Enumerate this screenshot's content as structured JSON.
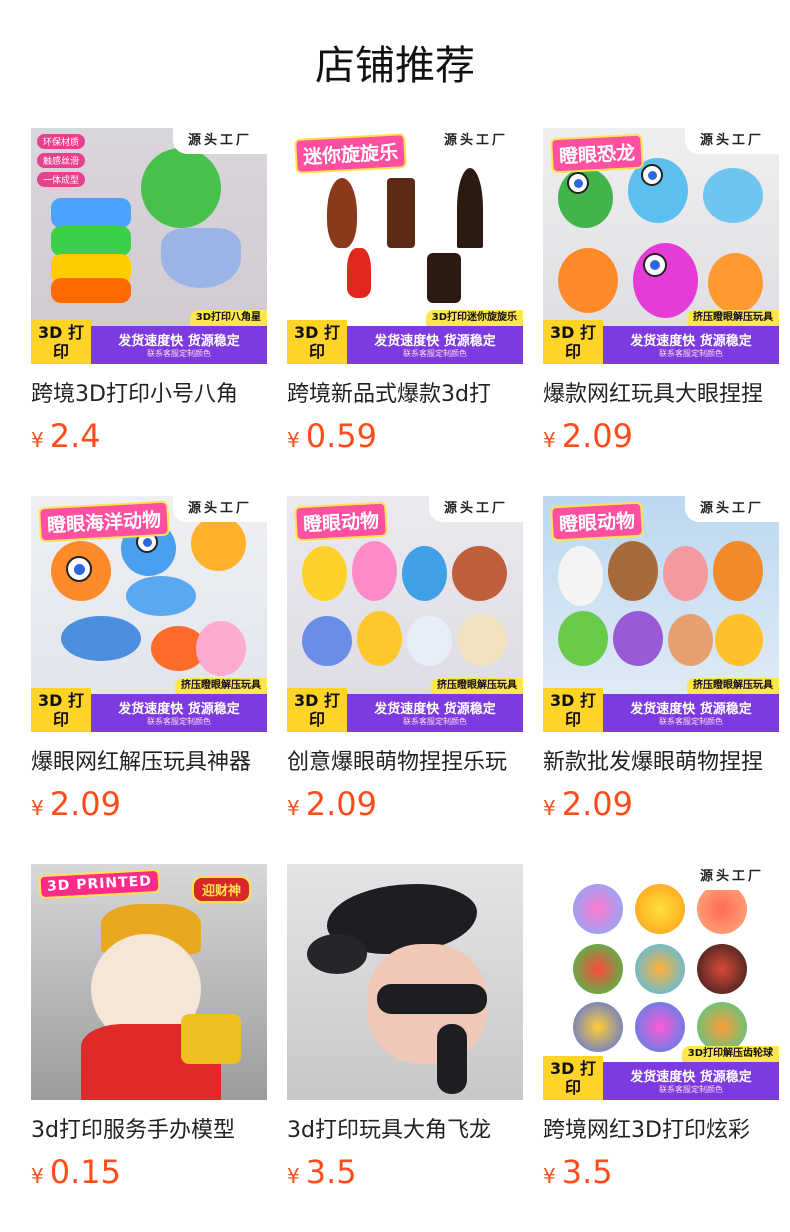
{
  "page_title": "店铺推荐",
  "products": [
    {
      "title": "跨境3D打印小号八角",
      "currency": "¥",
      "price": "2.4",
      "image": {
        "headline": "",
        "chips": [
          "环保材质",
          "触感丝滑",
          "一体成型"
        ],
        "tag": "3D打印八角星",
        "corner": "源头工厂",
        "badge_text": "3D 打印",
        "bar_main": "发货速度快 货源稳定",
        "bar_sub": "联系客服定制颜色"
      }
    },
    {
      "title": "跨境新品式爆款3d打",
      "currency": "¥",
      "price": "0.59",
      "image": {
        "headline": "迷你旋旋乐",
        "chips": [],
        "tag": "3D打印迷你旋旋乐",
        "corner": "源头工厂",
        "badge_text": "3D 打印",
        "bar_main": "发货速度快 货源稳定",
        "bar_sub": "联系客服定制颜色"
      }
    },
    {
      "title": "爆款网红玩具大眼捏捏",
      "currency": "¥",
      "price": "2.09",
      "image": {
        "headline": "瞪眼恐龙",
        "chips": [],
        "tag": "挤压瞪眼解压玩具",
        "corner": "源头工厂",
        "badge_text": "3D 打印",
        "bar_main": "发货速度快 货源稳定",
        "bar_sub": "联系客服定制颜色"
      }
    },
    {
      "title": "爆眼网红解压玩具神器",
      "currency": "¥",
      "price": "2.09",
      "image": {
        "headline": "瞪眼海洋动物",
        "chips": [],
        "tag": "挤压瞪眼解压玩具",
        "corner": "源头工厂",
        "badge_text": "3D 打印",
        "bar_main": "发货速度快 货源稳定",
        "bar_sub": "联系客服定制颜色"
      }
    },
    {
      "title": "创意爆眼萌物捏捏乐玩",
      "currency": "¥",
      "price": "2.09",
      "image": {
        "headline": "瞪眼动物",
        "chips": [],
        "tag": "挤压瞪眼解压玩具",
        "corner": "源头工厂",
        "badge_text": "3D 打印",
        "bar_main": "发货速度快 货源稳定",
        "bar_sub": "联系客服定制颜色"
      }
    },
    {
      "title": "新款批发爆眼萌物捏捏",
      "currency": "¥",
      "price": "2.09",
      "image": {
        "headline": "瞪眼动物",
        "chips": [],
        "tag": "挤压瞪眼解压玩具",
        "corner": "源头工厂",
        "badge_text": "3D 打印",
        "bar_main": "发货速度快 货源稳定",
        "bar_sub": "联系客服定制颜色"
      }
    },
    {
      "title": "3d打印服务手办模型",
      "currency": "¥",
      "price": "0.15",
      "image": {
        "headline": "3D PRINTED",
        "chips": [],
        "tag": "迎财神",
        "corner": "",
        "badge_text": "",
        "bar_main": "",
        "bar_sub": ""
      }
    },
    {
      "title": "3d打印玩具大角飞龙",
      "currency": "¥",
      "price": "3.5",
      "image": {
        "headline": "",
        "chips": [],
        "tag": "",
        "corner": "",
        "badge_text": "",
        "bar_main": "",
        "bar_sub": ""
      }
    },
    {
      "title": "跨境网红3D打印炫彩",
      "currency": "¥",
      "price": "3.5",
      "image": {
        "headline": "",
        "chips": [],
        "tag": "3D打印解压齿轮球",
        "corner": "源头工厂",
        "badge_text": "3D 打印",
        "bar_main": "发货速度快 货源稳定",
        "bar_sub": "联系客服定制颜色"
      }
    }
  ],
  "colors": {
    "price": "#ff4c1a",
    "banner_purple": "#7d3ae0",
    "banner_yellow": "#ffd426"
  }
}
